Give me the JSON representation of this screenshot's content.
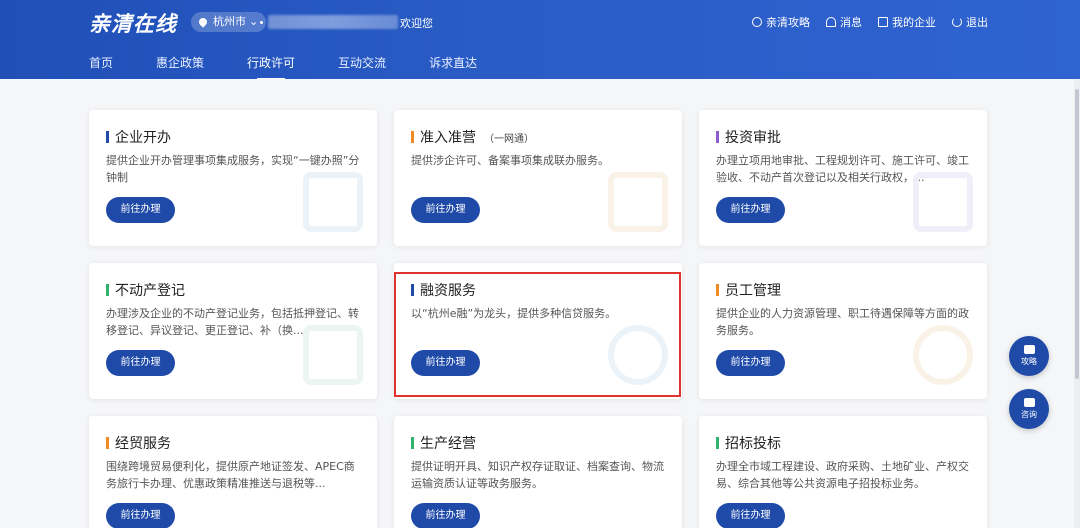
{
  "header": {
    "logo": "亲清在线",
    "city": "杭州市",
    "welcome": "欢迎您",
    "links": [
      "亲清攻略",
      "消息",
      "我的企业",
      "退出"
    ]
  },
  "nav": [
    "首页",
    "惠企政策",
    "行政许可",
    "互动交流",
    "诉求直达"
  ],
  "active_nav": "行政许可",
  "cards": [
    {
      "title": "企业开办",
      "sub": "",
      "color": "#1f4aa8",
      "desc": "提供企业开办管理事项集成服务，实现“一键办照”分钟制",
      "button": "前往办理"
    },
    {
      "title": "准入准营",
      "sub": "（一网通）",
      "color": "#f08a24",
      "desc": "提供涉企许可、备案事项集成联办服务。",
      "button": "前往办理"
    },
    {
      "title": "投资审批",
      "sub": "",
      "color": "#8a5cd0",
      "desc": "办理立项用地审批、工程规划许可、施工许可、竣工验收、不动产首次登记以及相关行政权，...",
      "button": "前往办理"
    },
    {
      "title": "不动产登记",
      "sub": "",
      "color": "#2fb36b",
      "desc": "办理涉及企业的不动产登记业务，包括抵押登记、转移登记、异议登记、更正登记、补（换...",
      "button": "前往办理"
    },
    {
      "title": "融资服务",
      "sub": "",
      "color": "#1f4aa8",
      "desc": "以“杭州e融”为龙头，提供多种信贷服务。",
      "button": "前往办理"
    },
    {
      "title": "员工管理",
      "sub": "",
      "color": "#f08a24",
      "desc": "提供企业的人力资源管理、职工待遇保障等方面的政务服务。",
      "button": "前往办理"
    },
    {
      "title": "经贸服务",
      "sub": "",
      "color": "#f08a24",
      "desc": "围绕跨境贸易便利化，提供原产地证签发、APEC商务旅行卡办理、优惠政策精准推送与退税等...",
      "button": "前往办理"
    },
    {
      "title": "生产经营",
      "sub": "",
      "color": "#2fb36b",
      "desc": "提供证明开具、知识产权存证取证、档案查询、物流运输资质认证等政务服务。",
      "button": "前往办理"
    },
    {
      "title": "招标投标",
      "sub": "",
      "color": "#2fb36b",
      "desc": "办理全市域工程建设、政府采购、土地矿业、产权交易、综合其他等公共资源电子招投标业务。",
      "button": "前往办理"
    }
  ],
  "floating": [
    "攻略",
    "咨询"
  ]
}
